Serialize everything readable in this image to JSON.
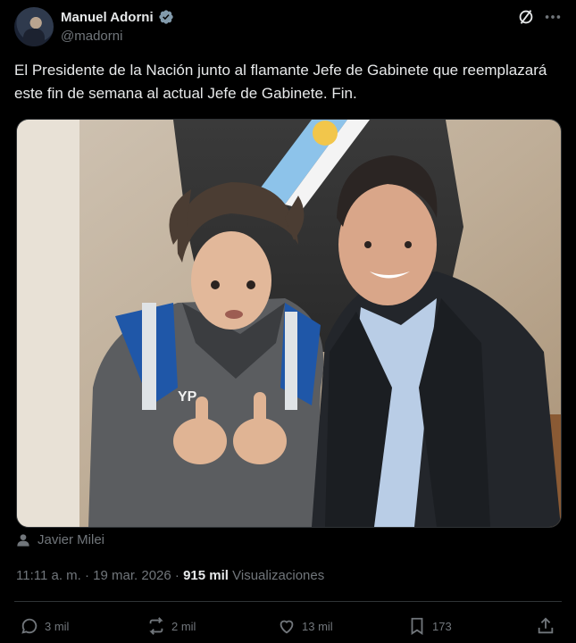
{
  "author": {
    "name": "Manuel Adorni",
    "handle": "@madorni",
    "verified_color": "#829aab"
  },
  "tweet": {
    "text": "El Presidente de la Nación junto al flamante Jefe de Gabinete que reemplazará este fin de semana al actual Jefe de Gabinete. Fin.",
    "tagged_user": "Javier Milei",
    "time": "11:11 a. m.",
    "date": "19 mar. 2026",
    "separator": "·",
    "views_count": "915 mil",
    "views_label": "Visualizaciones"
  },
  "actions": {
    "replies": "3 mil",
    "retweets": "2 mil",
    "likes": "13 mil",
    "bookmarks": "173"
  },
  "icons": [
    "grok-icon",
    "more-icon",
    "verified-icon",
    "person-icon",
    "reply-icon",
    "retweet-icon",
    "like-icon",
    "bookmark-icon",
    "share-icon"
  ],
  "colors": {
    "background": "#000000",
    "text": "#e7e9ea",
    "muted": "#71767b",
    "border": "#2f3336"
  }
}
